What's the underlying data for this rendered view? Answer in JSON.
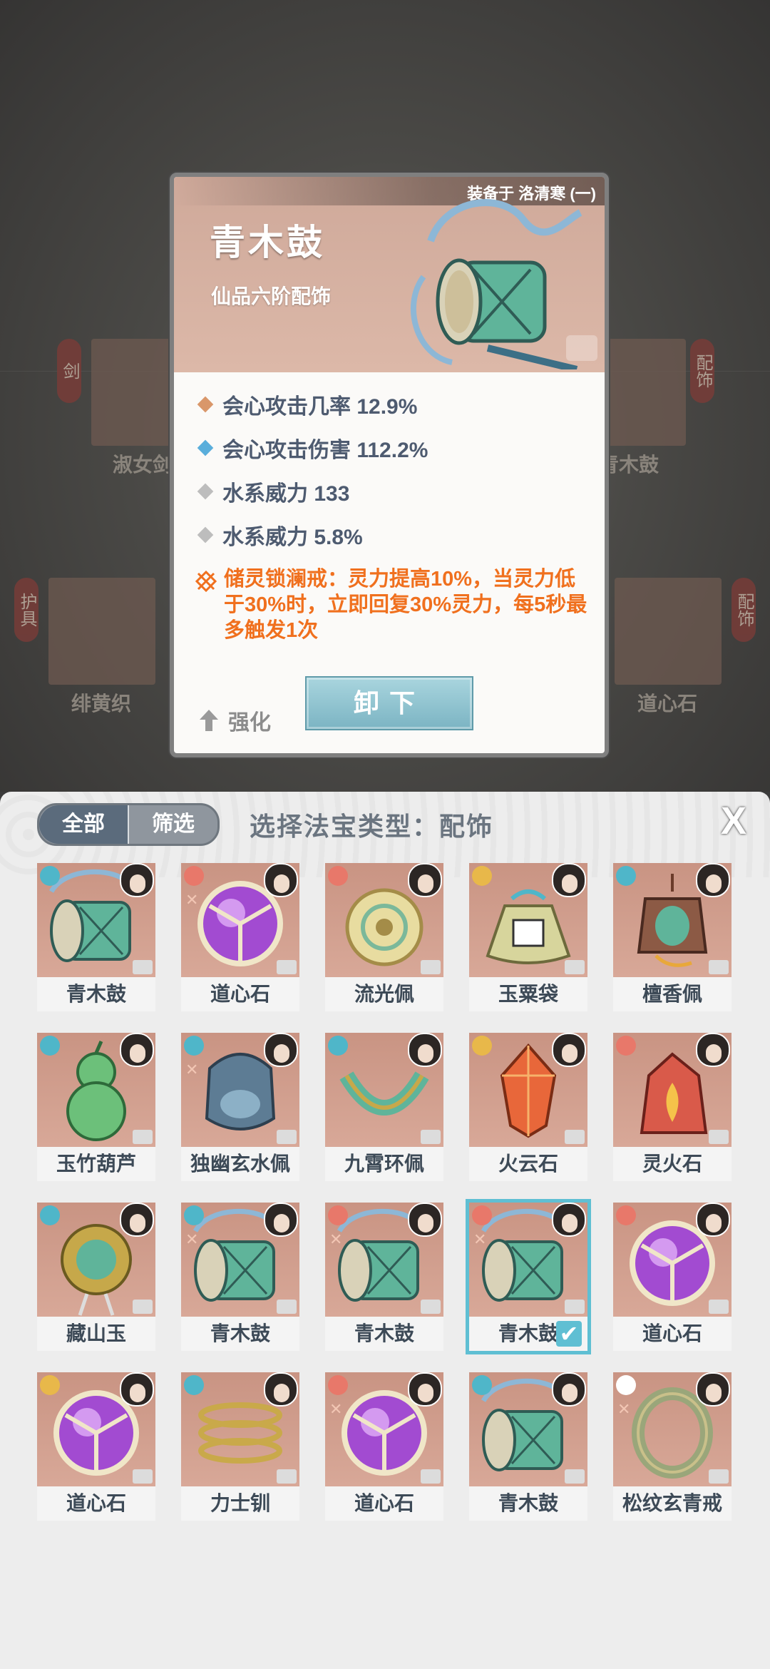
{
  "background": {
    "left_tags": [
      "剑",
      "护具"
    ],
    "right_tags": [
      "配饰",
      "配饰"
    ],
    "left_items": [
      "淑女剑",
      "绯黄织"
    ],
    "right_items": [
      "青木鼓",
      "道心石"
    ]
  },
  "popup": {
    "equipped_text": "装备于 洛清寒 (一)",
    "title": "青木鼓",
    "subtitle": "仙品六阶配饰",
    "stats": [
      {
        "text": "会心攻击几率 12.9%",
        "color": "#d9976a"
      },
      {
        "text": "会心攻击伤害 112.2%",
        "color": "#5aaedb"
      },
      {
        "text": "水系威力 133",
        "color": "#bdbdbd"
      },
      {
        "text": "水系威力 5.8%",
        "color": "#bdbdbd"
      }
    ],
    "skill_text": "储灵锁澜戒：灵力提高10%，当灵力低于30%时，立即回复30%灵力，每5秒最多触发1次",
    "enhance_label": "强化",
    "unload_label": "卸下"
  },
  "panel": {
    "tab_all": "全部",
    "tab_filter": "筛选",
    "title": "选择法宝类型：配饰",
    "close_glyph": "X"
  },
  "items": [
    {
      "name": "青木鼓",
      "art": "drum",
      "elem": "#4fb6c9",
      "rune": false
    },
    {
      "name": "道心石",
      "art": "orb",
      "elem": "#e8786a",
      "rune": true
    },
    {
      "name": "流光佩",
      "art": "disc",
      "elem": "#e8786a",
      "rune": false
    },
    {
      "name": "玉粟袋",
      "art": "bag",
      "elem": "#e8b84a",
      "rune": false
    },
    {
      "name": "檀香佩",
      "art": "pendant",
      "elem": "#4fb6c9",
      "rune": false
    },
    {
      "name": "玉竹葫芦",
      "art": "gourd",
      "elem": "#4fb6c9",
      "rune": false
    },
    {
      "name": "独幽玄水佩",
      "art": "jar",
      "elem": "#4fb6c9",
      "rune": true
    },
    {
      "name": "九霄环佩",
      "art": "ring",
      "elem": "#4fb6c9",
      "rune": false
    },
    {
      "name": "火云石",
      "art": "crystal",
      "elem": "#e8b84a",
      "rune": false
    },
    {
      "name": "灵火石",
      "art": "fire",
      "elem": "#e8786a",
      "rune": false
    },
    {
      "name": "藏山玉",
      "art": "jade",
      "elem": "#4fb6c9",
      "rune": false
    },
    {
      "name": "青木鼓",
      "art": "drum",
      "elem": "#4fb6c9",
      "rune": true
    },
    {
      "name": "青木鼓",
      "art": "drum",
      "elem": "#e8786a",
      "rune": true
    },
    {
      "name": "青木鼓",
      "art": "drum",
      "elem": "#e8786a",
      "rune": true,
      "selected": true
    },
    {
      "name": "道心石",
      "art": "orb",
      "elem": "#e8786a",
      "rune": false
    },
    {
      "name": "道心石",
      "art": "orb",
      "elem": "#e8b84a",
      "rune": false
    },
    {
      "name": "力士钏",
      "art": "coil",
      "elem": "#4fb6c9",
      "rune": false
    },
    {
      "name": "道心石",
      "art": "orb",
      "elem": "#e8786a",
      "rune": true
    },
    {
      "name": "青木鼓",
      "art": "drum",
      "elem": "#4fb6c9",
      "rune": false
    },
    {
      "name": "松纹玄青戒",
      "art": "band",
      "elem": "#ffffff",
      "rune": true
    }
  ]
}
